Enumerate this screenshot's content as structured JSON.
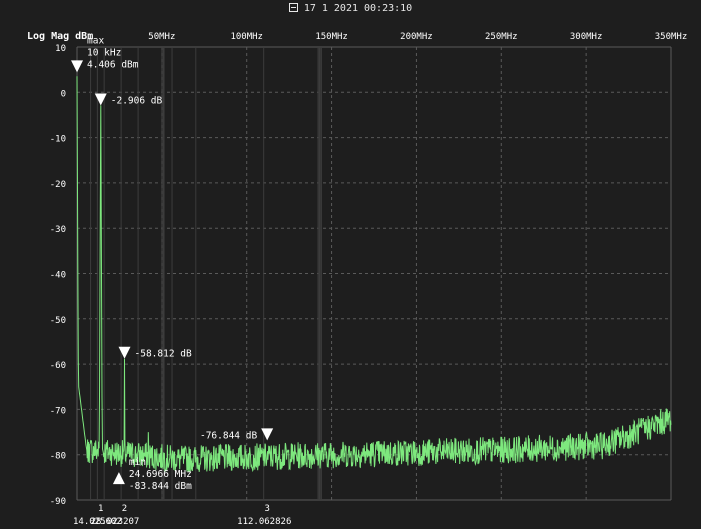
{
  "header": {
    "datetime": "17 1 2021 00:23:10"
  },
  "chart_data": {
    "type": "line",
    "ylabel": "Log Mag dBm",
    "xlim_mhz": [
      0,
      350
    ],
    "ylim": [
      -90,
      10
    ],
    "x_ticks": [
      {
        "mhz": 50,
        "label": "50MHz"
      },
      {
        "mhz": 100,
        "label": "100MHz"
      },
      {
        "mhz": 150,
        "label": "150MHz"
      },
      {
        "mhz": 200,
        "label": "200MHz"
      },
      {
        "mhz": 250,
        "label": "250MHz"
      },
      {
        "mhz": 300,
        "label": "300MHz"
      },
      {
        "mhz": 350,
        "label": "350MHz"
      }
    ],
    "y_ticks": [
      10,
      0,
      -10,
      -20,
      -30,
      -40,
      -50,
      -60,
      -70,
      -80,
      -90
    ],
    "y_tick_labels": [
      "10",
      "0",
      "-10",
      "-20",
      "-30",
      "-40",
      "-50",
      "-60",
      "-70",
      "-80",
      "-90"
    ],
    "grid": true,
    "trace_color": "#7ee87e",
    "marker_color": "#ffffff",
    "grid_color": "#5a5a5a",
    "peaks": [
      {
        "mhz": 0.01,
        "db": 4.4
      },
      {
        "mhz": 14.0,
        "db": -2.9
      },
      {
        "mhz": 28.0,
        "db": -58.8
      },
      {
        "mhz": 42.0,
        "db": -75.0
      }
    ],
    "noise_floor": [
      {
        "mhz": 8,
        "db": -79
      },
      {
        "mhz": 60,
        "db": -81
      },
      {
        "mhz": 150,
        "db": -80
      },
      {
        "mhz": 250,
        "db": -79
      },
      {
        "mhz": 310,
        "db": -78
      },
      {
        "mhz": 350,
        "db": -72
      }
    ],
    "markers": [
      {
        "id": "max",
        "mhz": 0.01,
        "db": 4.406,
        "direction": "down",
        "lines": [
          "max",
          "10 kHz",
          "4.406 dBm"
        ]
      },
      {
        "id": "1",
        "mhz": 14.0,
        "db": -2.906,
        "direction": "down",
        "lines": [
          "-2.906 dB"
        ],
        "axis_label": "1"
      },
      {
        "id": "2",
        "mhz": 28.0,
        "db": -58.812,
        "direction": "down",
        "lines": [
          "-58.812 dB"
        ],
        "axis_label": "2"
      },
      {
        "id": "3",
        "mhz": 112.062826,
        "db": -76.844,
        "direction": "down",
        "lines": [
          "-76.844 dB"
        ],
        "axis_label": "3",
        "label_side": "left"
      },
      {
        "id": "min",
        "mhz": 24.6966,
        "db": -83.844,
        "direction": "up",
        "lines": [
          "min",
          "24.6966 MHz",
          "-83.844 dBm"
        ]
      }
    ],
    "bottom_readouts": [
      "14.025602",
      "28.023207",
      "112.062826"
    ]
  }
}
